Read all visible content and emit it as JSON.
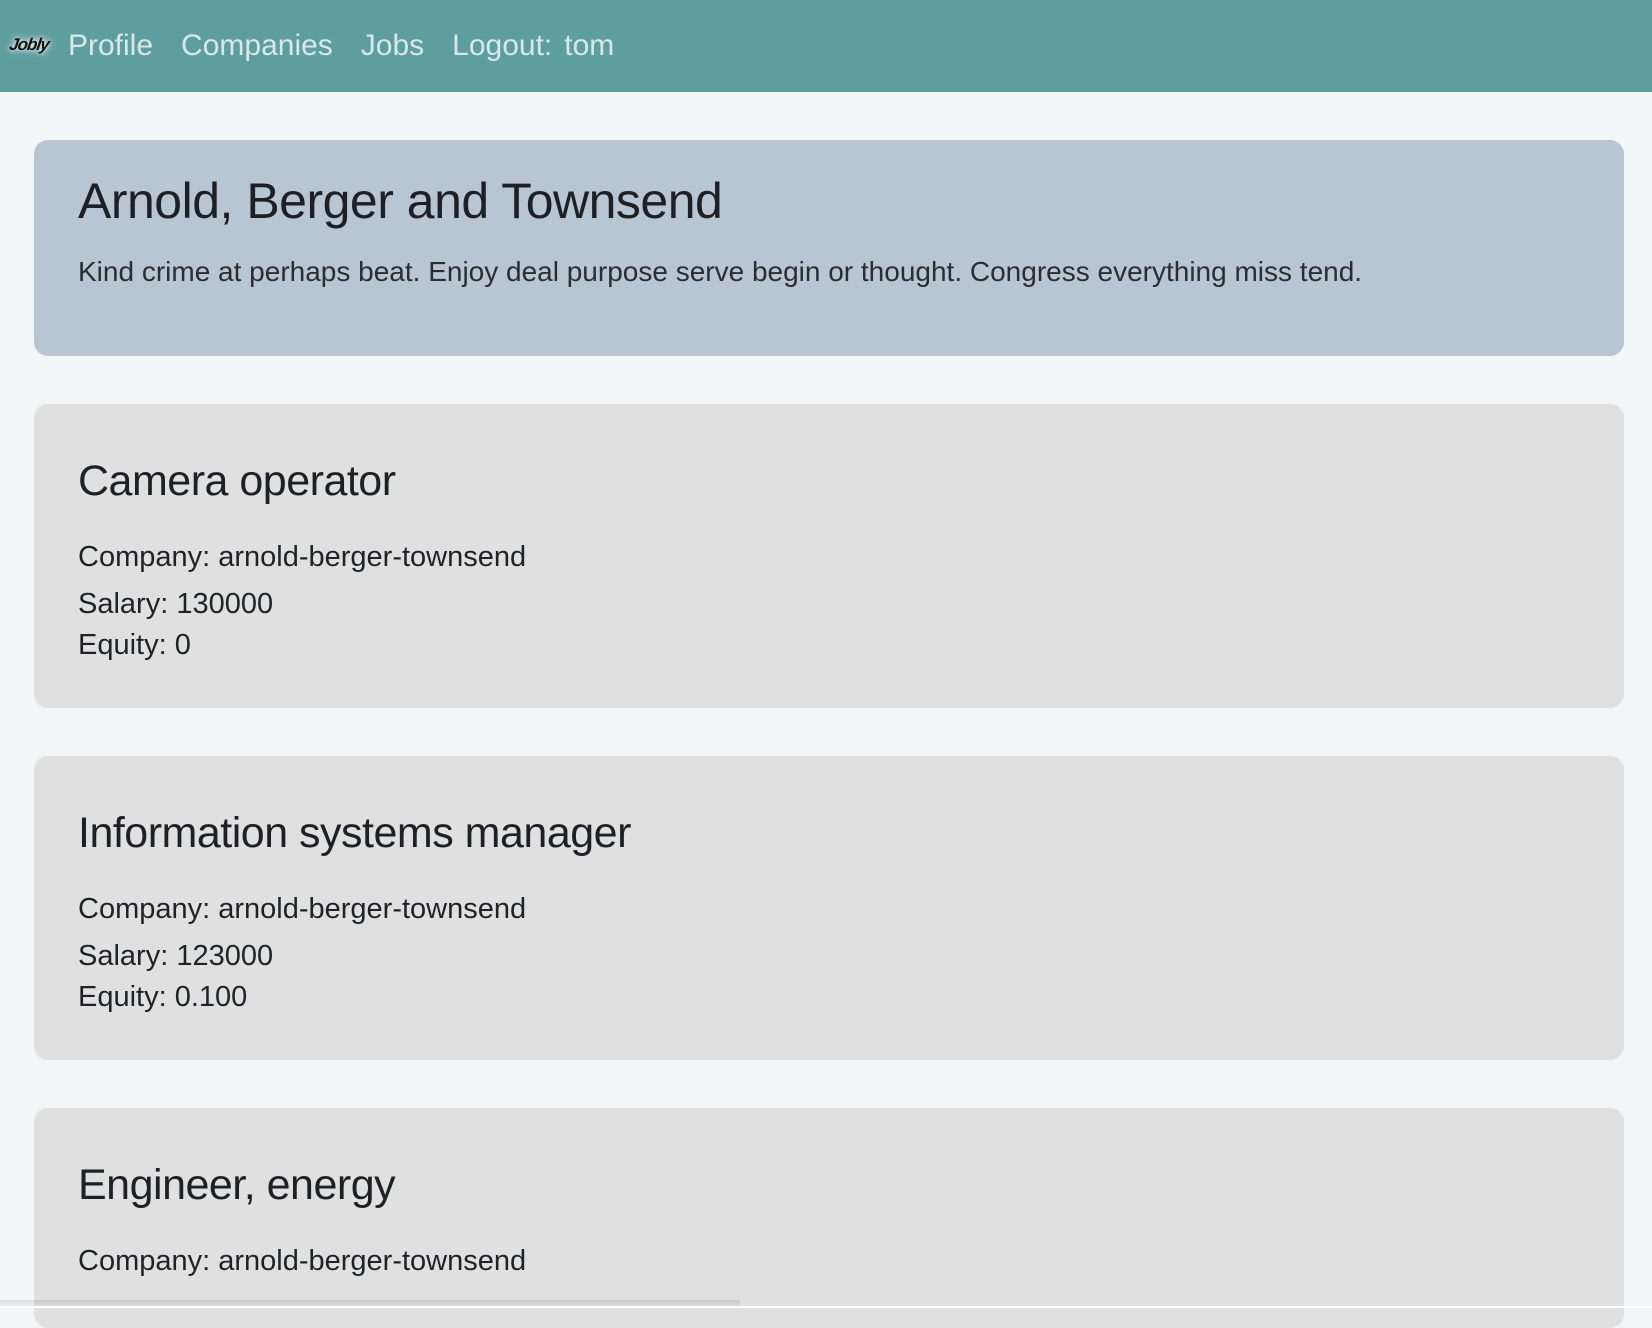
{
  "nav": {
    "brand": "Jobly",
    "links": [
      {
        "label": "Profile"
      },
      {
        "label": "Companies"
      },
      {
        "label": "Jobs"
      }
    ],
    "logout_label": "Logout:",
    "username": "tom"
  },
  "company": {
    "name": "Arnold, Berger and Townsend",
    "description": "Kind crime at perhaps beat. Enjoy deal purpose serve begin or thought. Congress everything miss tend."
  },
  "jobs": [
    {
      "title": "Camera operator",
      "company": "Company: arnold-berger-townsend",
      "salary": "Salary: 130000",
      "equity": "Equity: 0"
    },
    {
      "title": "Information systems manager",
      "company": "Company: arnold-berger-townsend",
      "salary": "Salary: 123000",
      "equity": "Equity: 0.100"
    },
    {
      "title": "Engineer, energy",
      "company": "Company: arnold-berger-townsend",
      "salary": "",
      "equity": ""
    }
  ],
  "colors": {
    "navbar": "#5f9ea0",
    "company_card": "#b8c6d3",
    "job_card": "#e0e0e0",
    "page_bg": "#f3f6f7"
  }
}
